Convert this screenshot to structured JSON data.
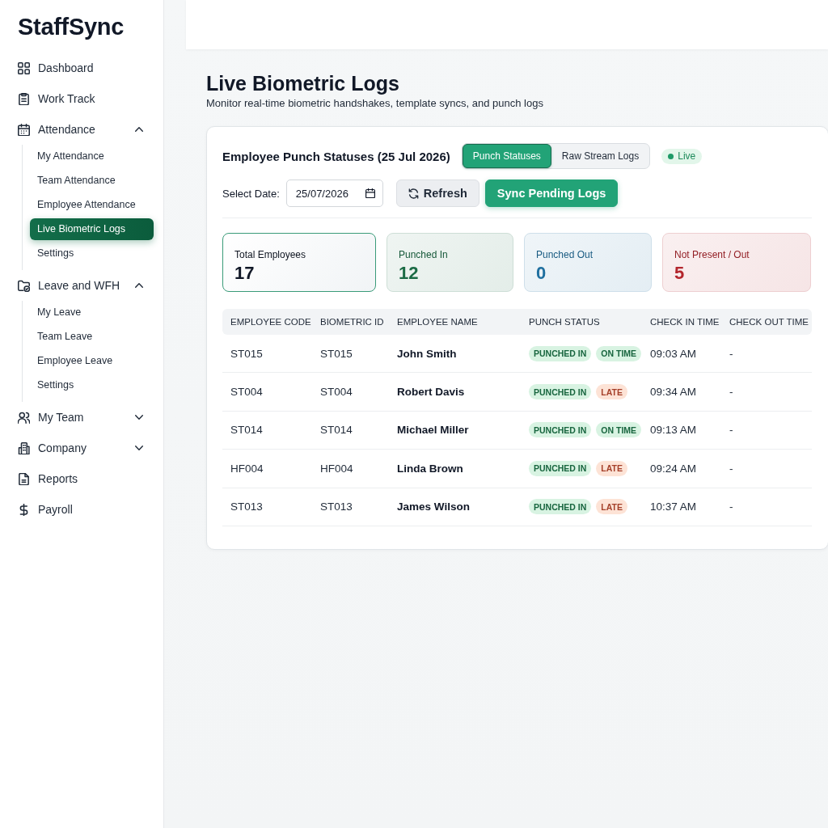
{
  "sidebar": {
    "logo": "StaffSync",
    "items": [
      {
        "label": "Dashboard",
        "kind": "link",
        "selected": false
      },
      {
        "label": "Work Track",
        "kind": "link",
        "selected": false
      },
      {
        "label": "Attendance",
        "kind": "group",
        "selected": false,
        "expanded": true,
        "children": [
          {
            "label": "My Attendance",
            "selected": false
          },
          {
            "label": "Team Attendance",
            "selected": false
          },
          {
            "label": "Employee Attendance",
            "selected": false
          },
          {
            "label": "Live Biometric Logs",
            "selected": true
          },
          {
            "label": "Settings",
            "selected": false
          }
        ]
      },
      {
        "label": "Leave and WFH",
        "kind": "group",
        "selected": false,
        "expanded": true,
        "children": [
          {
            "label": "My Leave",
            "selected": false
          },
          {
            "label": "Team Leave",
            "selected": false
          },
          {
            "label": "Employee Leave",
            "selected": false
          },
          {
            "label": "Settings",
            "selected": false
          }
        ]
      },
      {
        "label": "My Team",
        "kind": "group",
        "selected": false,
        "expanded": false
      },
      {
        "label": "Company",
        "kind": "group",
        "selected": false,
        "expanded": false
      },
      {
        "label": "Reports",
        "kind": "link",
        "selected": false
      },
      {
        "label": "Payroll",
        "kind": "link",
        "selected": false
      }
    ]
  },
  "page": {
    "title": "Live Biometric Logs",
    "subtitle": "Monitor real-time biometric handshakes, template syncs, and punch logs"
  },
  "panel": {
    "title": "Employee Punch Statuses (25 Jul 2026)",
    "tabs": [
      {
        "label": "Punch Statuses",
        "selected": true
      },
      {
        "label": "Raw Stream Logs",
        "selected": false
      }
    ],
    "live": {
      "label": "Live",
      "on": true
    },
    "date_label": "Select Date:",
    "date_field": {
      "value": "25/07/2026"
    },
    "buttons": [
      {
        "label": "Refresh",
        "kind": "secondary"
      },
      {
        "label": "Sync Pending Logs",
        "kind": "primary"
      }
    ],
    "stats": [
      {
        "label": "Total Employees",
        "value": "17",
        "color": "#111827",
        "selected": true
      },
      {
        "label": "Punched In",
        "value": "12",
        "color": "#1b6b45",
        "selected": false
      },
      {
        "label": "Punched Out",
        "value": "0",
        "color": "#1f6f9f",
        "selected": false
      },
      {
        "label": "Not Present / Out",
        "value": "5",
        "color": "#b3262d",
        "selected": false
      }
    ],
    "table": {
      "columns": [
        "EMPLOYEE CODE",
        "BIOMETRIC ID",
        "EMPLOYEE NAME",
        "PUNCH STATUS",
        "CHECK IN TIME",
        "CHECK OUT TIME"
      ],
      "rows": [
        {
          "employee_code": "ST015",
          "biometric_id": "ST015",
          "employee_name": "John Smith",
          "punch_status": {
            "label": "PUNCHED IN",
            "kind": "in"
          },
          "timing": {
            "label": "ON TIME",
            "kind": "on_time"
          },
          "check_in_time": "09:03 AM",
          "check_out_time": "-"
        },
        {
          "employee_code": "ST004",
          "biometric_id": "ST004",
          "employee_name": "Robert Davis",
          "punch_status": {
            "label": "PUNCHED IN",
            "kind": "in"
          },
          "timing": {
            "label": "LATE",
            "kind": "late"
          },
          "check_in_time": "09:34 AM",
          "check_out_time": "-"
        },
        {
          "employee_code": "ST014",
          "biometric_id": "ST014",
          "employee_name": "Michael Miller",
          "punch_status": {
            "label": "PUNCHED IN",
            "kind": "in"
          },
          "timing": {
            "label": "ON TIME",
            "kind": "on_time"
          },
          "check_in_time": "09:13 AM",
          "check_out_time": "-"
        },
        {
          "employee_code": "HF004",
          "biometric_id": "HF004",
          "employee_name": "Linda Brown",
          "punch_status": {
            "label": "PUNCHED IN",
            "kind": "in"
          },
          "timing": {
            "label": "LATE",
            "kind": "late"
          },
          "check_in_time": "09:24 AM",
          "check_out_time": "-"
        },
        {
          "employee_code": "ST013",
          "biometric_id": "ST013",
          "employee_name": "James Wilson",
          "punch_status": {
            "label": "PUNCHED IN",
            "kind": "in"
          },
          "timing": {
            "label": "LATE",
            "kind": "late"
          },
          "check_in_time": "10:37 AM",
          "check_out_time": "-"
        }
      ]
    }
  }
}
